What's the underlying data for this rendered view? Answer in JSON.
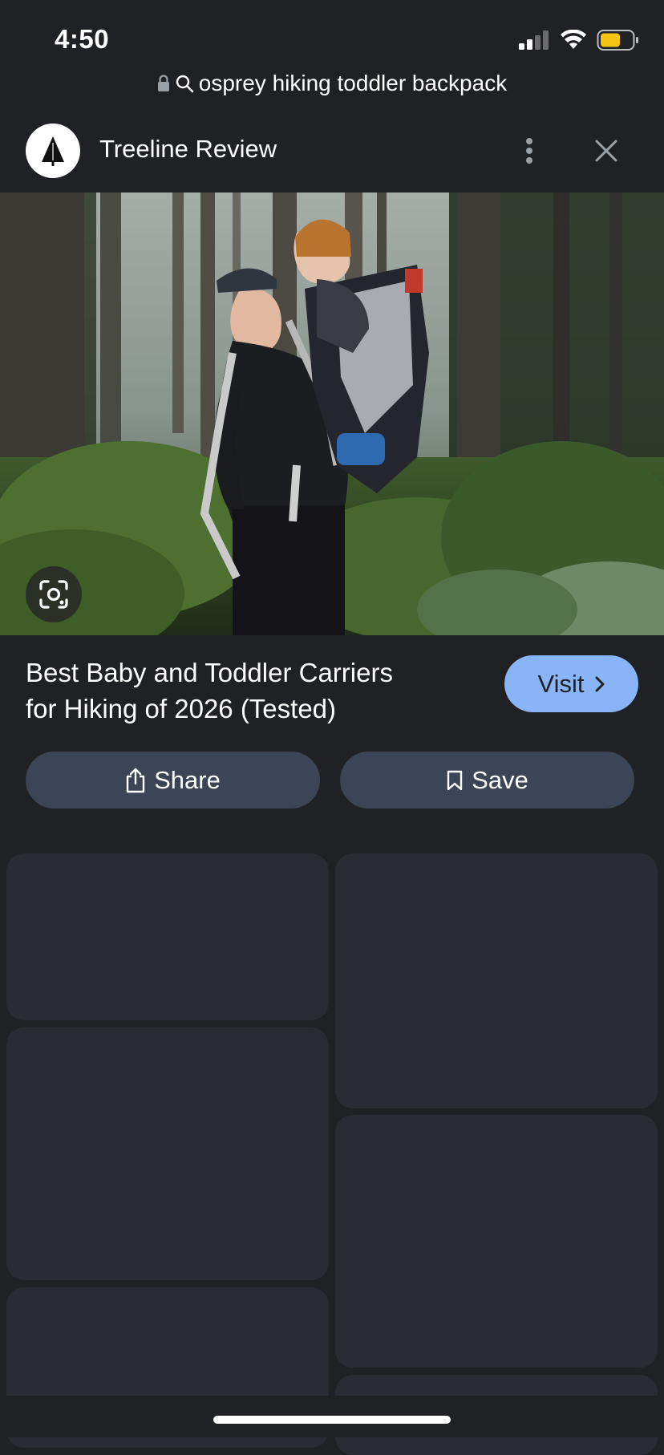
{
  "status": {
    "time": "4:50",
    "battery_color": "#f6c512"
  },
  "url_bar": {
    "query": "osprey hiking toddler backpack"
  },
  "site": {
    "name": "Treeline Review"
  },
  "result": {
    "title_line1": "Best Baby and Toddler Carriers",
    "title_line2": "for Hiking of 2026 (Tested)"
  },
  "actions": {
    "visit_label": "Visit",
    "share_label": "Share",
    "save_label": "Save"
  },
  "colors": {
    "background": "#202124",
    "accent": "#8ab4f8",
    "button": "#3c4555",
    "tile": "#2a2c33"
  },
  "icons": [
    "lock-icon",
    "search-icon",
    "more-vert-icon",
    "close-icon",
    "google-lens-icon",
    "chevron-right-icon",
    "share-icon",
    "bookmark-icon"
  ]
}
